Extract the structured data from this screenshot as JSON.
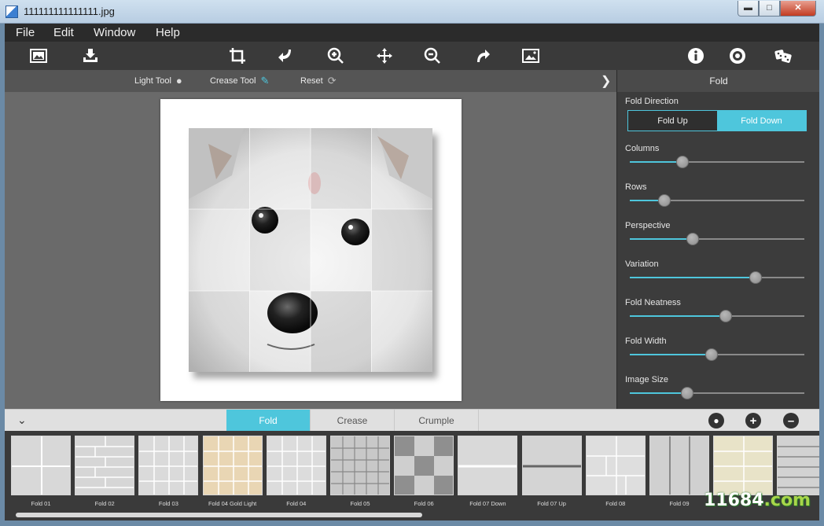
{
  "window": {
    "title": "111111111111111.jpg"
  },
  "menu": [
    "File",
    "Edit",
    "Window",
    "Help"
  ],
  "toolbar": {
    "items": [
      "open-image-icon",
      "save-icon",
      "crop-icon",
      "rotate-left-icon",
      "zoom-in-icon",
      "pan-icon",
      "zoom-out-icon",
      "rotate-right-icon",
      "fit-image-icon",
      "info-icon",
      "settings-icon",
      "random-dice-icon"
    ]
  },
  "subtoolbar": {
    "light_tool": "Light Tool",
    "crease_tool": "Crease Tool",
    "reset": "Reset"
  },
  "panel": {
    "title": "Fold",
    "fold_direction_label": "Fold Direction",
    "fold_up": "Fold Up",
    "fold_down": "Fold Down",
    "selected_direction": "Fold Down",
    "sliders": [
      {
        "label": "Columns",
        "value": 0.3
      },
      {
        "label": "Rows",
        "value": 0.2
      },
      {
        "label": "Perspective",
        "value": 0.36
      },
      {
        "label": "Variation",
        "value": 0.72
      },
      {
        "label": "Fold Neatness",
        "value": 0.55
      },
      {
        "label": "Fold Width",
        "value": 0.47
      },
      {
        "label": "Image Size",
        "value": 0.33
      }
    ],
    "accent_color": "#4ec6dc"
  },
  "bottom_tabs": {
    "tabs": [
      "Fold",
      "Crease",
      "Crumple"
    ],
    "active": "Fold"
  },
  "presets": [
    "Fold 01",
    "Fold 02",
    "Fold 03",
    "Fold 04 Gold Light",
    "Fold 04",
    "Fold 05",
    "Fold 06",
    "Fold 07 Down",
    "Fold 07 Up",
    "Fold 08",
    "Fold 09",
    "",
    ""
  ],
  "watermark": {
    "main": "11684",
    "suffix": ".com"
  }
}
